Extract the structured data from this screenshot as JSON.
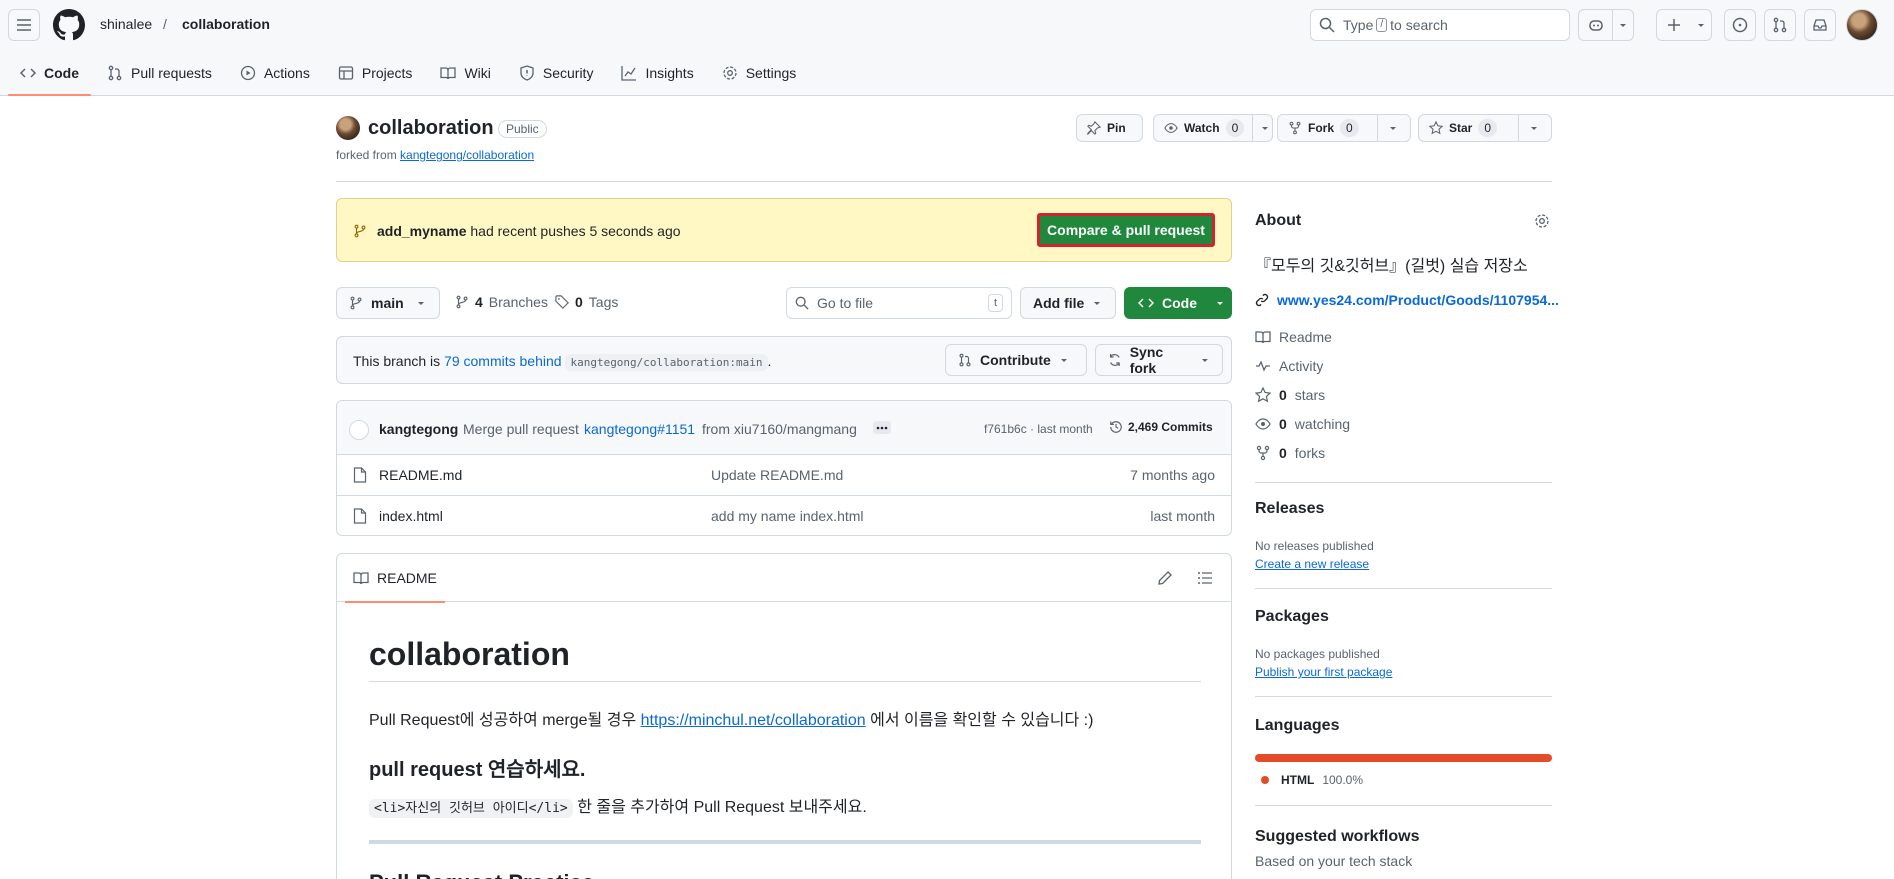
{
  "header": {
    "owner": "shinalee",
    "separator": "/",
    "repo": "collaboration",
    "search_prefix": "Type",
    "search_key": "/",
    "search_suffix": "to search"
  },
  "tabs": [
    {
      "label": "Code",
      "icon": "code-icon",
      "active": true
    },
    {
      "label": "Pull requests",
      "icon": "git-pull-request-icon"
    },
    {
      "label": "Actions",
      "icon": "play-icon"
    },
    {
      "label": "Projects",
      "icon": "table-icon"
    },
    {
      "label": "Wiki",
      "icon": "book-icon"
    },
    {
      "label": "Security",
      "icon": "shield-icon"
    },
    {
      "label": "Insights",
      "icon": "graph-icon"
    },
    {
      "label": "Settings",
      "icon": "gear-icon"
    }
  ],
  "repo_head": {
    "name": "collaboration",
    "visibility": "Public",
    "forked_prefix": "forked from",
    "forked_link": "kangtegong/collaboration",
    "pin_label": "Pin",
    "watch_label": "Watch",
    "watch_count": "0",
    "fork_label": "Fork",
    "fork_count": "0",
    "star_label": "Star",
    "star_count": "0"
  },
  "banner": {
    "branch": "add_myname",
    "text": "had recent pushes 5 seconds ago",
    "button": "Compare & pull request"
  },
  "toolbar": {
    "branch": "main",
    "branches_count": "4",
    "branches_label": "Branches",
    "tags_count": "0",
    "tags_label": "Tags",
    "file_search_placeholder": "Go to file",
    "file_search_key": "t",
    "add_file": "Add file",
    "code": "Code"
  },
  "behind": {
    "prefix": "This branch is",
    "link": "79 commits behind",
    "ref": "kangtegong/collaboration:main",
    "suffix": ".",
    "contribute": "Contribute",
    "sync": "Sync fork"
  },
  "commit": {
    "author": "kangtegong",
    "message_prefix": "Merge pull request",
    "pr_link": "kangtegong#1151",
    "message_suffix": "from xiu7160/mangmang",
    "sha_time": "f761b6c · last month",
    "commits": "2,469 Commits"
  },
  "files": [
    {
      "name": "README.md",
      "message": "Update README.md",
      "age": "7 months ago"
    },
    {
      "name": "index.html",
      "message": "add my name index.html",
      "age": "last month"
    }
  ],
  "readme": {
    "tab": "README",
    "h1": "collaboration",
    "p1_prefix": "Pull Request에 성공하여 merge될 경우",
    "p1_link": "https://minchul.net/collaboration",
    "p1_suffix": "에서 이름을 확인할 수 있습니다 :)",
    "h3": "pull request 연습하세요.",
    "p2_code": "<li>자신의 깃허브 아이디</li>",
    "p2_suffix": "한 줄을 추가하여 Pull Request 보내주세요.",
    "h2_cut": "Pull Request Practice"
  },
  "sidebar": {
    "about": "About",
    "description": "『모두의 깃&깃허브』(길벗) 실습 저장소",
    "website": "www.yes24.com/Product/Goods/1107954...",
    "readme": "Readme",
    "activity": "Activity",
    "stars_count": "0",
    "stars": "stars",
    "watching_count": "0",
    "watching": "watching",
    "forks_count": "0",
    "forks": "forks",
    "releases": "Releases",
    "no_releases": "No releases published",
    "create_release": "Create a new release",
    "packages": "Packages",
    "no_packages": "No packages published",
    "publish_package": "Publish your first package",
    "languages": "Languages",
    "lang_name": "HTML",
    "lang_pct": "100.0%",
    "lang_color": "#e34c26",
    "suggested": "Suggested workflows",
    "suggested_sub": "Based on your tech stack"
  },
  "colors": {
    "accent_green": "#1f883d",
    "link_blue": "#0969da",
    "banner_yellow": "#fff8c5",
    "highlight_red": "#d1242f",
    "tab_underline": "#fd8c73"
  }
}
